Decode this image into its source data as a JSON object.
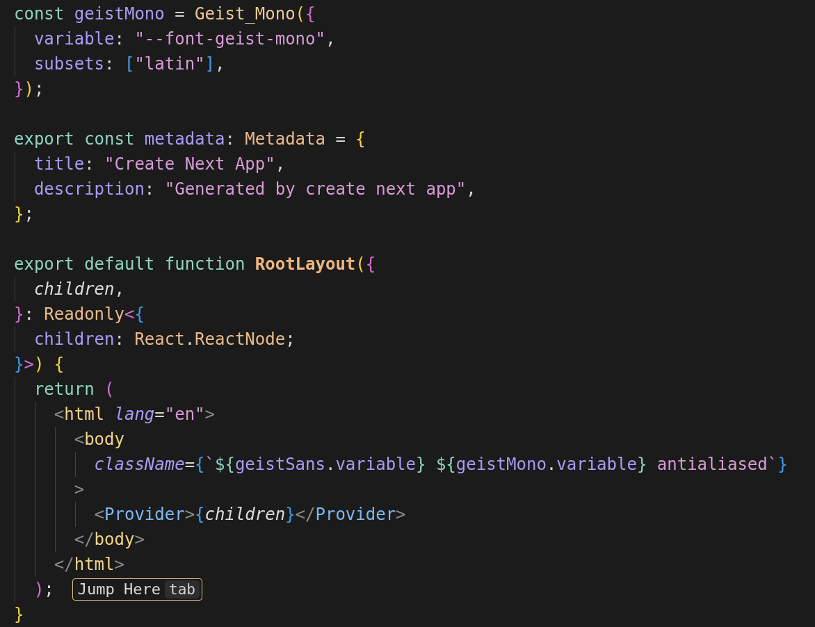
{
  "editor": {
    "lines": [
      {
        "kind": "code",
        "tokens": [
          {
            "text": "const ",
            "kind": "kw"
          },
          {
            "text": "geistMono",
            "kind": "var"
          },
          {
            "text": " = ",
            "kind": "punct"
          },
          {
            "text": "Geist_Mono",
            "kind": "func"
          },
          {
            "text": "(",
            "kind": "b1"
          },
          {
            "text": "{",
            "kind": "b2"
          }
        ]
      },
      {
        "kind": "code",
        "tokens": [
          {
            "text": "  variable",
            "kind": "var"
          },
          {
            "text": ": ",
            "kind": "punct"
          },
          {
            "text": "\"--font-geist-mono\"",
            "kind": "str"
          },
          {
            "text": ",",
            "kind": "punct"
          }
        ]
      },
      {
        "kind": "code",
        "tokens": [
          {
            "text": "  subsets",
            "kind": "var"
          },
          {
            "text": ": ",
            "kind": "punct"
          },
          {
            "text": "[",
            "kind": "b3"
          },
          {
            "text": "\"latin\"",
            "kind": "str"
          },
          {
            "text": "]",
            "kind": "b3"
          },
          {
            "text": ",",
            "kind": "punct"
          }
        ]
      },
      {
        "kind": "code",
        "tokens": [
          {
            "text": "}",
            "kind": "b2"
          },
          {
            "text": ")",
            "kind": "b1"
          },
          {
            "text": ";",
            "kind": "punct"
          }
        ]
      },
      {
        "kind": "blank"
      },
      {
        "kind": "code",
        "tokens": [
          {
            "text": "export const ",
            "kind": "kw"
          },
          {
            "text": "metadata",
            "kind": "var"
          },
          {
            "text": ": ",
            "kind": "punct"
          },
          {
            "text": "Metadata",
            "kind": "type"
          },
          {
            "text": " = ",
            "kind": "punct"
          },
          {
            "text": "{",
            "kind": "b1"
          }
        ]
      },
      {
        "kind": "code",
        "tokens": [
          {
            "text": "  title",
            "kind": "var"
          },
          {
            "text": ": ",
            "kind": "punct"
          },
          {
            "text": "\"Create Next App\"",
            "kind": "str"
          },
          {
            "text": ",",
            "kind": "punct"
          }
        ]
      },
      {
        "kind": "code",
        "tokens": [
          {
            "text": "  description",
            "kind": "var"
          },
          {
            "text": ": ",
            "kind": "punct"
          },
          {
            "text": "\"Generated by create next app\"",
            "kind": "str"
          },
          {
            "text": ",",
            "kind": "punct"
          }
        ]
      },
      {
        "kind": "code",
        "tokens": [
          {
            "text": "}",
            "kind": "b1"
          },
          {
            "text": ";",
            "kind": "punct"
          }
        ]
      },
      {
        "kind": "blank"
      },
      {
        "kind": "code",
        "tokens": [
          {
            "text": "export default function ",
            "kind": "kw"
          },
          {
            "text": "RootLayout",
            "kind": "fdef"
          },
          {
            "text": "(",
            "kind": "b1"
          },
          {
            "text": "{",
            "kind": "b2"
          }
        ]
      },
      {
        "kind": "code",
        "tokens": [
          {
            "text": "  children",
            "kind": "param"
          },
          {
            "text": ",",
            "kind": "punct"
          }
        ]
      },
      {
        "kind": "code",
        "tokens": [
          {
            "text": "}",
            "kind": "b2"
          },
          {
            "text": ": ",
            "kind": "punct"
          },
          {
            "text": "Readonly",
            "kind": "type"
          },
          {
            "text": "<",
            "kind": "b2"
          },
          {
            "text": "{",
            "kind": "b3"
          }
        ]
      },
      {
        "kind": "code",
        "tokens": [
          {
            "text": "  children",
            "kind": "var"
          },
          {
            "text": ": ",
            "kind": "punct"
          },
          {
            "text": "React",
            "kind": "type"
          },
          {
            "text": ".",
            "kind": "punct"
          },
          {
            "text": "ReactNode",
            "kind": "type"
          },
          {
            "text": ";",
            "kind": "punct"
          }
        ]
      },
      {
        "kind": "code",
        "tokens": [
          {
            "text": "}",
            "kind": "b3"
          },
          {
            "text": ">",
            "kind": "b2"
          },
          {
            "text": ")",
            "kind": "b1"
          },
          {
            "text": " {",
            "kind": "b1"
          }
        ]
      },
      {
        "kind": "code",
        "tokens": [
          {
            "text": "  return ",
            "kind": "kw"
          },
          {
            "text": "(",
            "kind": "b2"
          }
        ]
      },
      {
        "kind": "code",
        "tokens": [
          {
            "text": "    <",
            "kind": "tagp"
          },
          {
            "text": "html ",
            "kind": "tag"
          },
          {
            "text": "lang",
            "kind": "attr"
          },
          {
            "text": "=",
            "kind": "punct"
          },
          {
            "text": "\"en\"",
            "kind": "str"
          },
          {
            "text": ">",
            "kind": "tagp"
          }
        ]
      },
      {
        "kind": "code",
        "tokens": [
          {
            "text": "      <",
            "kind": "tagp"
          },
          {
            "text": "body",
            "kind": "tag"
          }
        ]
      },
      {
        "kind": "code",
        "tokens": [
          {
            "text": "        className",
            "kind": "attr"
          },
          {
            "text": "=",
            "kind": "punct"
          },
          {
            "text": "{",
            "kind": "b3"
          },
          {
            "text": "`",
            "kind": "str"
          },
          {
            "text": "${",
            "kind": "tpl"
          },
          {
            "text": "geistSans",
            "kind": "var"
          },
          {
            "text": ".",
            "kind": "punct"
          },
          {
            "text": "variable",
            "kind": "var"
          },
          {
            "text": "} ",
            "kind": "tpl"
          },
          {
            "text": "${",
            "kind": "tpl"
          },
          {
            "text": "geistMono",
            "kind": "var"
          },
          {
            "text": ".",
            "kind": "punct"
          },
          {
            "text": "variable",
            "kind": "var"
          },
          {
            "text": "}",
            "kind": "tpl"
          },
          {
            "text": " antialiased`",
            "kind": "str"
          },
          {
            "text": "}",
            "kind": "b3"
          }
        ]
      },
      {
        "kind": "code",
        "tokens": [
          {
            "text": "      >",
            "kind": "tagp"
          }
        ]
      },
      {
        "kind": "code",
        "tokens": [
          {
            "text": "        <",
            "kind": "tagp"
          },
          {
            "text": "Provider",
            "kind": "comp"
          },
          {
            "text": ">",
            "kind": "tagp"
          },
          {
            "text": "{",
            "kind": "b3"
          },
          {
            "text": "children",
            "kind": "param"
          },
          {
            "text": "}",
            "kind": "b3"
          },
          {
            "text": "</",
            "kind": "tagp"
          },
          {
            "text": "Provider",
            "kind": "comp"
          },
          {
            "text": ">",
            "kind": "tagp"
          }
        ]
      },
      {
        "kind": "code",
        "tokens": [
          {
            "text": "      </",
            "kind": "tagp"
          },
          {
            "text": "body",
            "kind": "tag"
          },
          {
            "text": ">",
            "kind": "tagp"
          }
        ]
      },
      {
        "kind": "code",
        "tokens": [
          {
            "text": "    </",
            "kind": "tagp"
          },
          {
            "text": "html",
            "kind": "tag"
          },
          {
            "text": ">",
            "kind": "tagp"
          }
        ]
      },
      {
        "kind": "code",
        "tokens": [
          {
            "text": "  )",
            "kind": "b2"
          },
          {
            "text": ";",
            "kind": "punct"
          }
        ],
        "hint": {
          "label": "Jump Here",
          "key": "tab"
        }
      },
      {
        "kind": "code",
        "tokens": [
          {
            "text": "}",
            "kind": "b1"
          }
        ]
      }
    ]
  }
}
